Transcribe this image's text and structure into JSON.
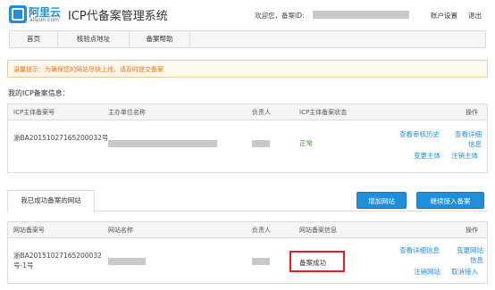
{
  "header": {
    "logo_cn": "阿里云",
    "logo_en": "aliyun.com",
    "title": "ICP代备案管理系统",
    "welcome": "欢迎您，备案ID:",
    "account_settings": "账户设置",
    "logout": "退出"
  },
  "nav": {
    "items": [
      {
        "label": "首页"
      },
      {
        "label": "核验点地址"
      },
      {
        "label": "备案帮助"
      }
    ]
  },
  "notice": {
    "text": "温馨提示：为确保您的网站尽快上线，请及时提交备案"
  },
  "subject_section": {
    "title": "我的ICP备案信息：",
    "columns": [
      "ICP主体备案号",
      "主办单位名称",
      "负责人",
      "ICP主体备案状态",
      "操作"
    ],
    "row": {
      "record_no": "浙BA20151027165200032号",
      "status": "正常",
      "actions": [
        "查看审核历史",
        "查看详细信息",
        "变更主体",
        "注销主体"
      ]
    }
  },
  "website_section": {
    "tab": "我已成功备案的网站",
    "add_site": "增加网站",
    "continue_access": "继续接入备案",
    "columns": [
      "网站备案号",
      "网站名称",
      "负责人",
      "网站备案信息",
      "操作"
    ],
    "row": {
      "record_no": "浙BA20151027165200032号-1号",
      "status": "备案成功",
      "actions": [
        "查看详细信息",
        "变更网站信息",
        "注销网站",
        "取消接入"
      ]
    }
  },
  "colors": {
    "brand": "#1e8fd8",
    "notice": "#e0751b",
    "ok": "#3c9a2e",
    "highlight": "#e02020"
  }
}
